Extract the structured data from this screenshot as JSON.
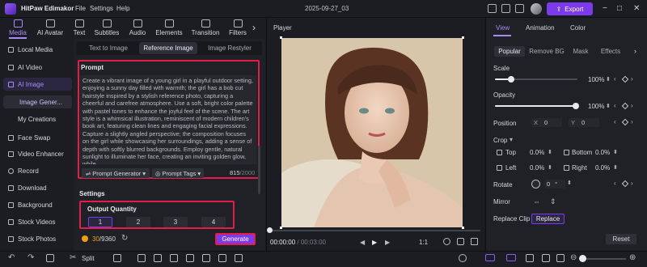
{
  "app": {
    "title": "HitPaw Edimakor",
    "menu": [
      "File",
      "Settings",
      "Help"
    ],
    "project_title": "2025-09-27_03",
    "export_label": "Export"
  },
  "toolbar_tabs": [
    {
      "label": "Media",
      "icon": "media-icon",
      "active": true
    },
    {
      "label": "AI Avatar",
      "icon": "ai-avatar-icon"
    },
    {
      "label": "Text",
      "icon": "text-icon"
    },
    {
      "label": "Subtitles",
      "icon": "subtitles-icon"
    },
    {
      "label": "Audio",
      "icon": "audio-icon"
    },
    {
      "label": "Elements",
      "icon": "elements-icon"
    },
    {
      "label": "Transition",
      "icon": "transition-icon"
    },
    {
      "label": "Filters",
      "icon": "filters-icon"
    }
  ],
  "sidebar": {
    "local_media": "Local Media",
    "ai_video": "AI Video",
    "ai_image": "AI Image",
    "image_gen": "Image Gener...",
    "my_creations": "My Creations",
    "face_swap": "Face Swap",
    "video_enhancer": "Video Enhancer",
    "record": "Record",
    "download": "Download",
    "background": "Background",
    "stock_videos": "Stock Videos",
    "stock_photos": "Stock Photos"
  },
  "panel": {
    "modes": [
      "Text to Image",
      "Reference Image",
      "Image Restyler"
    ],
    "active_mode": "Reference Image",
    "prompt_label": "Prompt",
    "prompt_text": "Create a vibrant image of a young girl in a playful outdoor setting, enjoying a sunny day filled with warmth; the girl has a bob cut hairstyle inspired by a stylish reference photo, capturing a cheerful and carefree atmosphere. Use a soft, bright color palette with pastel tones to enhance the joyful feel of the scene. The art style is a whimsical illustration, reminiscent of modern children's book art, featuring clean lines and engaging facial expressions. Capture a slightly angled perspective; the composition focuses on the girl while showcasing her surroundings, adding a sense of depth with softly blurred backgrounds. Employ gentle, natural sunlight to illuminate her face, creating an inviting golden glow, while",
    "prompt_generator": "Prompt Generator",
    "prompt_tags": "Prompt Tags",
    "char_count": "815",
    "char_max": "/2000",
    "settings_label": "Settings",
    "output_quantity_label": "Output Quantity",
    "quantities": [
      "1",
      "2",
      "3",
      "4"
    ],
    "selected_quantity": "1",
    "credits_used": "30",
    "credits_total": "/9360",
    "generate_label": "Generate"
  },
  "player": {
    "label": "Player",
    "current_time": "00:00:00",
    "total_time": "/ 00:03:00",
    "ratio": "1:1",
    "progress": 0
  },
  "properties": {
    "tabs": [
      "View",
      "Animation",
      "Color"
    ],
    "active_tab": "View",
    "subtabs": [
      "Popular",
      "Remove BG",
      "Mask",
      "Effects"
    ],
    "active_subtab": "Popular",
    "scale_label": "Scale",
    "scale_value": "100%",
    "scale_level": 1.0,
    "opacity_label": "Opacity",
    "opacity_value": "100%",
    "opacity_level": 1.0,
    "position_label": "Position",
    "pos_x_label": "X",
    "pos_x": "0",
    "pos_y_label": "Y",
    "pos_y": "0",
    "crop_label": "Crop",
    "crop_top_label": "Top",
    "crop_top": "0.0%",
    "crop_bottom_label": "Bottom",
    "crop_bottom": "0.0%",
    "crop_left_label": "Left",
    "crop_left": "0.0%",
    "crop_right_label": "Right",
    "crop_right": "0.0%",
    "rotate_label": "Rotate",
    "rotate_value": "0",
    "rotate_unit": "°",
    "mirror_label": "Mirror",
    "replace_clip_label": "Replace Clip",
    "replace_label": "Replace",
    "reset_label": "Reset"
  },
  "bottombar": {
    "split_label": "Split"
  },
  "colors": {
    "accent": "#7c3aed",
    "accent_light": "#a78bfa",
    "highlight": "#e11d48",
    "bg": "#16181c"
  }
}
